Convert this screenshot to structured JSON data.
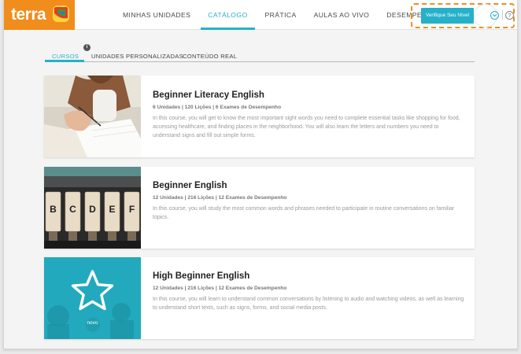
{
  "brand": {
    "name": "terra",
    "orange": "#f08d1c",
    "accent": "#25b1c8"
  },
  "nav": {
    "items": [
      {
        "label": "MINHAS UNIDADES",
        "active": false
      },
      {
        "label": "CATÁLOGO",
        "active": true
      },
      {
        "label": "PRÁTICA",
        "active": false
      },
      {
        "label": "AULAS AO VIVO",
        "active": false
      },
      {
        "label": "DESEMPENHO",
        "active": false
      }
    ]
  },
  "header_actions": {
    "level_button": "Verifique Seu Nível",
    "avatar_icon": "user-avatar-icon",
    "chevron_icon": "chevron-down-icon",
    "help_icon": "help-icon",
    "help_glyph": "?"
  },
  "tabs": {
    "items": [
      {
        "label": "CURSOS",
        "active": true
      },
      {
        "label": "UNIDADES PERSONALIZADAS",
        "active": false
      },
      {
        "label": "CONTEÚDO REAL",
        "active": false
      }
    ],
    "info_badge": "i"
  },
  "courses": [
    {
      "title": "Beginner Literacy English",
      "meta": "6 Unidades | 120 Lições | 6 Exames de Desempenho",
      "description": "In this course, you will get to know the most important sight words you need to complete essential tasks like shopping for food, accessing healthcare, and finding places in the neighborhood. You will also learn the letters and numbers you need to understand signs and fill out simple forms.",
      "image": "writing-hand-photo"
    },
    {
      "title": "Beginner English",
      "meta": "12 Unidades | 216 Lições | 12 Exames de Desempenho",
      "description": "In this course, you will study the most common words and phrases needed to participate in routine conversations on familiar topics.",
      "image": "letter-blocks-photo",
      "blocks": [
        "B",
        "C",
        "D",
        "E",
        "F"
      ]
    },
    {
      "title": "High Beginner English",
      "meta": "12 Unidades | 216 Lições | 12 Exames de Desempenho",
      "description": "In this course, you will learn to understand common conversations by listening to audio and watching videos, as well as learning to understand short texts, such as signs, forms, and social media posts.",
      "image": "star-overlay-photo",
      "overlay_caption": "novo"
    }
  ]
}
